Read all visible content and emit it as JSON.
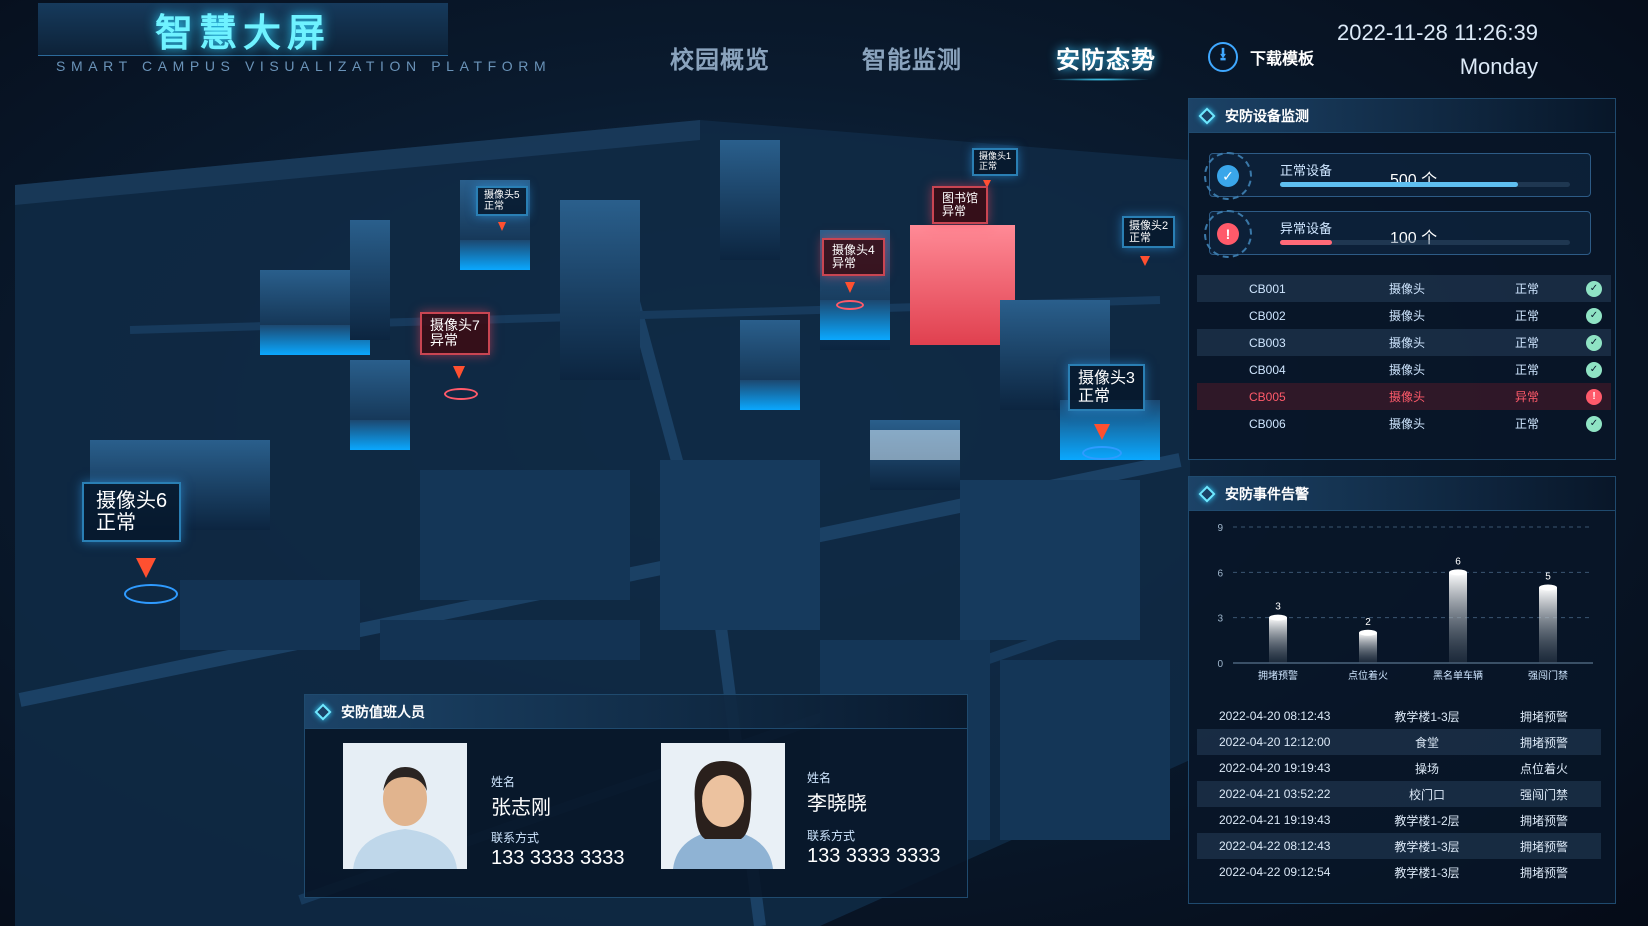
{
  "header": {
    "title": "智慧大屏",
    "subtitle": "SMART CAMPUS VISUALIZATION PLATFORM",
    "nav": [
      {
        "label": "校园概览",
        "active": false
      },
      {
        "label": "智能监测",
        "active": false
      },
      {
        "label": "安防态势",
        "active": true
      }
    ],
    "download_label": "下载模板",
    "date": "2022-11-28 11:26:39",
    "weekday": "Monday"
  },
  "map_labels": [
    {
      "name": "摄像头1",
      "status": "正常"
    },
    {
      "name": "摄像头2",
      "status": "正常"
    },
    {
      "name": "摄像头3",
      "status": "正常"
    },
    {
      "name": "摄像头4",
      "status": "异常"
    },
    {
      "name": "摄像头5",
      "status": "正常"
    },
    {
      "name": "摄像头6",
      "status": "正常"
    },
    {
      "name": "摄像头7",
      "status": "异常"
    },
    {
      "name": "图书馆",
      "status": "异常"
    }
  ],
  "device_panel": {
    "title": "安防设备监测",
    "normal": {
      "label": "正常设备",
      "value": "500 个",
      "fraction": 0.82
    },
    "abnormal": {
      "label": "异常设备",
      "value": "100 个",
      "fraction": 0.18
    },
    "rows": [
      {
        "id": "CB001",
        "type": "摄像头",
        "status": "正常"
      },
      {
        "id": "CB002",
        "type": "摄像头",
        "status": "正常"
      },
      {
        "id": "CB003",
        "type": "摄像头",
        "status": "正常"
      },
      {
        "id": "CB004",
        "type": "摄像头",
        "status": "正常"
      },
      {
        "id": "CB005",
        "type": "摄像头",
        "status": "异常"
      },
      {
        "id": "CB006",
        "type": "摄像头",
        "status": "正常"
      }
    ]
  },
  "event_panel": {
    "title": "安防事件告警",
    "rows": [
      {
        "time": "2022-04-20 08:12:43",
        "place": "教学楼1-3层",
        "type": "拥堵预警"
      },
      {
        "time": "2022-04-20 12:12:00",
        "place": "食堂",
        "type": "拥堵预警"
      },
      {
        "time": "2022-04-20 19:19:43",
        "place": "操场",
        "type": "点位着火"
      },
      {
        "time": "2022-04-21 03:52:22",
        "place": "校门口",
        "type": "强闯门禁"
      },
      {
        "time": "2022-04-21 19:19:43",
        "place": "教学楼1-2层",
        "type": "拥堵预警"
      },
      {
        "time": "2022-04-22 08:12:43",
        "place": "教学楼1-3层",
        "type": "拥堵预警"
      },
      {
        "time": "2022-04-22 09:12:54",
        "place": "教学楼1-3层",
        "type": "拥堵预警"
      }
    ]
  },
  "chart_data": {
    "type": "bar",
    "categories": [
      "拥堵预警",
      "点位着火",
      "黑名单车辆",
      "强闯门禁"
    ],
    "values": [
      3,
      2,
      6,
      5
    ],
    "ylim": [
      0,
      9
    ],
    "yticks": [
      0,
      3,
      6,
      9
    ],
    "grid": true,
    "title": "",
    "xlabel": "",
    "ylabel": ""
  },
  "staff_panel": {
    "title": "安防值班人员",
    "name_label": "姓名",
    "tel_label": "联系方式",
    "people": [
      {
        "name": "张志刚",
        "tel": "133 3333 3333"
      },
      {
        "name": "李晓晓",
        "tel": "133 3333 3333"
      }
    ]
  },
  "colors": {
    "accent": "#44d8ff",
    "normal": "#8fe3c4",
    "abnormal": "#ff5a6a"
  }
}
